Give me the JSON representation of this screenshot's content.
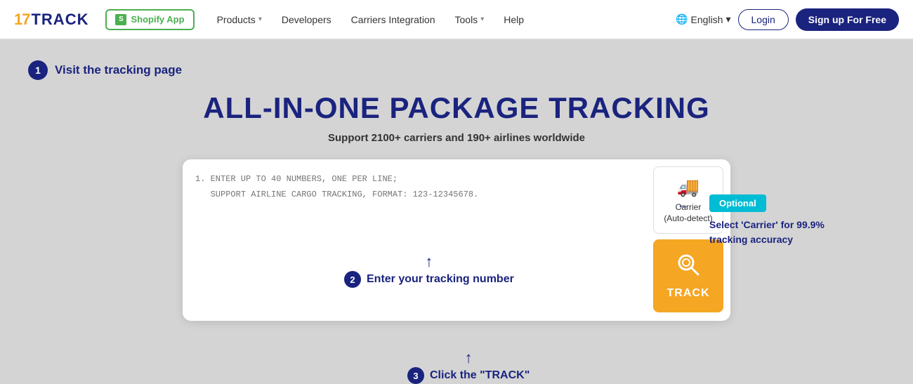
{
  "logo": {
    "part1": "17",
    "part2": "TRACK"
  },
  "nav": {
    "shopify_label": "Shopify App",
    "products_label": "Products",
    "developers_label": "Developers",
    "carriers_label": "Carriers Integration",
    "tools_label": "Tools",
    "help_label": "Help",
    "language_label": "English",
    "login_label": "Login",
    "signup_label": "Sign up For Free"
  },
  "step1": {
    "badge": "1",
    "text": "Visit the tracking page"
  },
  "hero": {
    "title": "ALL-IN-ONE PACKAGE TRACKING",
    "subtitle": "Support 2100+ carriers and 190+ airlines worldwide"
  },
  "textarea": {
    "placeholder_line1": "1. ENTER UP TO 40 NUMBERS, ONE PER LINE;",
    "placeholder_line2": "   SUPPORT AIRLINE CARGO TRACKING, FORMAT: 123-12345678."
  },
  "carrier_btn": {
    "icon": "🚚",
    "line1": "Carrier",
    "line2": "(Auto-detect)"
  },
  "track_btn": {
    "label": "TRACK"
  },
  "annotation_enter": {
    "badge": "2",
    "text": "Enter your tracking number"
  },
  "annotation_optional": {
    "tag": "Optional",
    "text": "Select 'Carrier' for 99.9% tracking accuracy"
  },
  "annotation_track": {
    "badge": "3",
    "text": "Click the \"TRACK\""
  }
}
